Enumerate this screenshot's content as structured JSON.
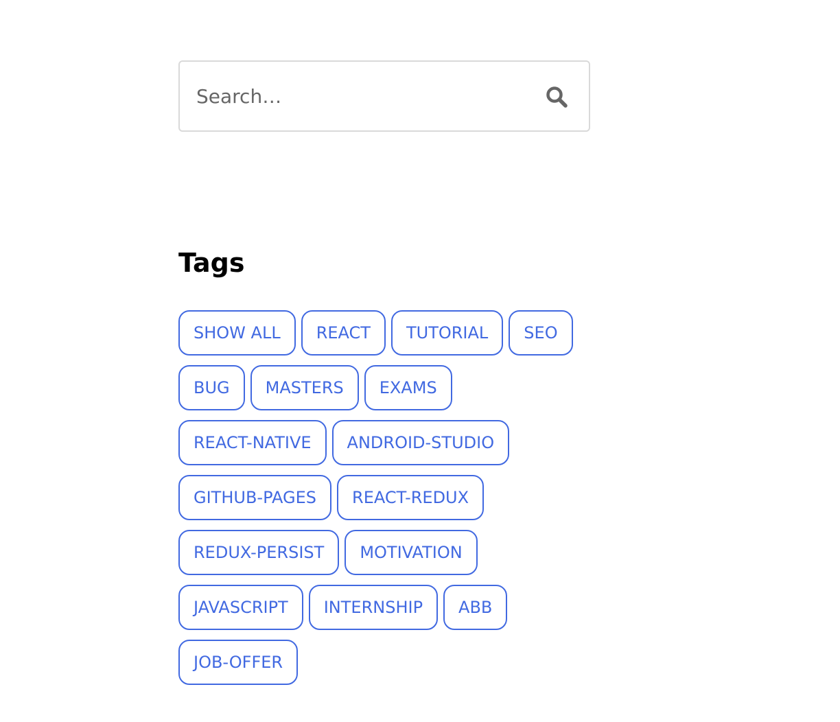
{
  "search": {
    "placeholder": "Search…",
    "value": ""
  },
  "search_icon": "search-icon",
  "tags": {
    "title": "Tags",
    "accent_color": "#4169e1",
    "rows": [
      [
        "SHOW ALL",
        "REACT",
        "TUTORIAL",
        "SEO"
      ],
      [
        "BUG",
        "MASTERS",
        "EXAMS"
      ],
      [
        "REACT-NATIVE",
        "ANDROID-STUDIO"
      ],
      [
        "GITHUB-PAGES",
        "REACT-REDUX"
      ],
      [
        "REDUX-PERSIST",
        "MOTIVATION"
      ],
      [
        "JAVASCRIPT",
        "INTERNSHIP",
        "ABB"
      ],
      [
        "JOB-OFFER"
      ]
    ]
  }
}
